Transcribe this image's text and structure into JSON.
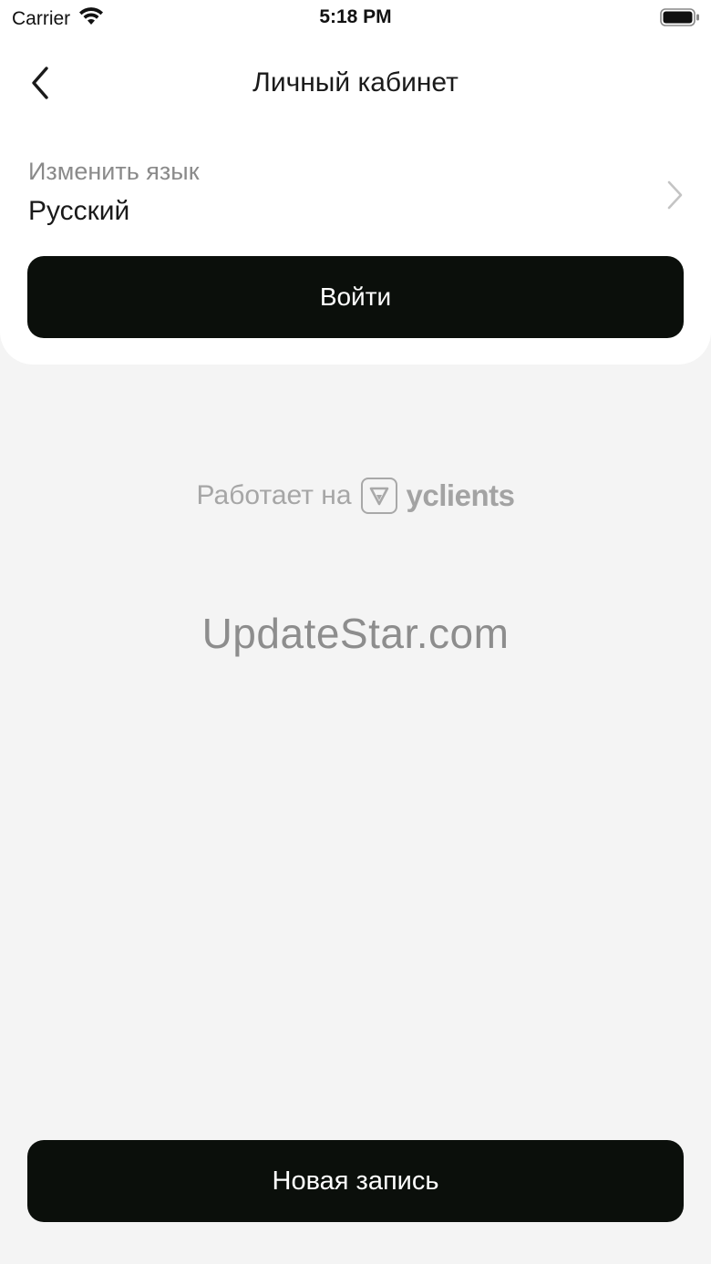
{
  "status_bar": {
    "carrier": "Carrier",
    "time": "5:18 PM"
  },
  "header": {
    "title": "Личный кабинет"
  },
  "language": {
    "label": "Изменить язык",
    "value": "Русский"
  },
  "buttons": {
    "login": "Войти",
    "new_booking": "Новая запись"
  },
  "footer_branding": {
    "powered_by": "Работает на",
    "brand": "yclients"
  },
  "watermark": "UpdateStar.com",
  "colors": {
    "button_bg": "#0b0f0b",
    "page_bg": "#f4f4f4",
    "card_bg": "#ffffff",
    "muted_text": "#8a8a8a"
  },
  "icons": [
    "wifi-icon",
    "battery-icon",
    "back-arrow-icon",
    "chevron-right-icon",
    "yclients-logo-icon"
  ]
}
